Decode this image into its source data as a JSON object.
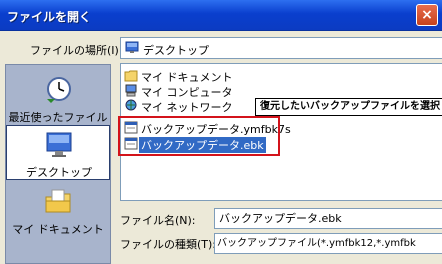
{
  "window": {
    "title": "ファイルを開く",
    "close_glyph": "×"
  },
  "location": {
    "label": "ファイルの場所(I):",
    "value": "デスクトップ",
    "icon": "desktop-icon"
  },
  "places": [
    {
      "label": "最近使ったファイル",
      "icon": "recent-icon"
    },
    {
      "label": "デスクトップ",
      "icon": "desktop-icon",
      "selected": true
    },
    {
      "label": "マイ ドキュメント",
      "icon": "documents-icon"
    }
  ],
  "files": [
    {
      "name": "マイ ドキュメント",
      "icon": "folder-icon"
    },
    {
      "name": "マイ コンピュータ",
      "icon": "computer-icon"
    },
    {
      "name": "マイ ネットワーク",
      "icon": "network-icon"
    },
    {
      "name": "バックアップデータ.ymfbk7s",
      "icon": "file-icon"
    },
    {
      "name": "バックアップデータ.ebk",
      "icon": "file-icon",
      "selected": true
    }
  ],
  "callout": {
    "text": "復元したいバックアップファイルを選択"
  },
  "filename": {
    "label": "ファイル名(N):",
    "value": "バックアップデータ.ebk"
  },
  "filetype": {
    "label": "ファイルの種類(T):",
    "value": "バックアップファイル(*.ymfbk12,*.ymfbk"
  },
  "colors": {
    "titlebar": "#0a3fce",
    "highlight_border": "#d3131b",
    "selection": "#316ac5"
  }
}
